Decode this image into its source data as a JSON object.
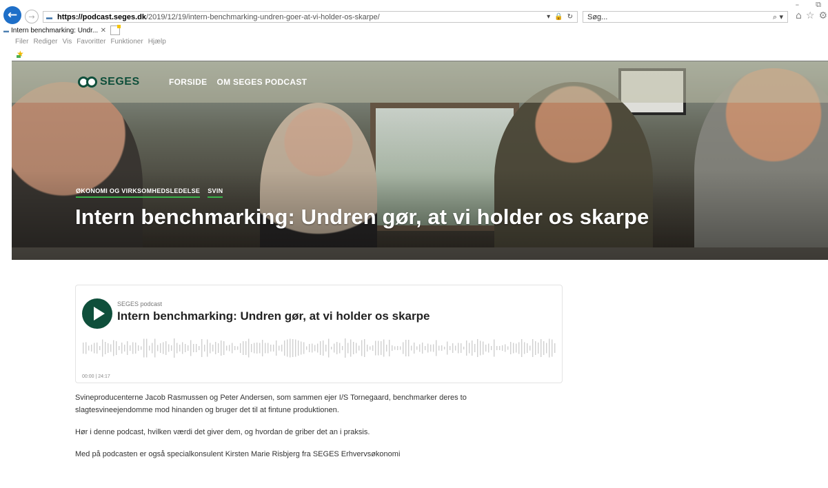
{
  "browser": {
    "url_host": "https://podcast.seges.dk",
    "url_path": "/2019/12/19/intern-benchmarking-undren-goer-at-vi-holder-os-skarpe/",
    "search_placeholder": "Søg...",
    "tab_title": "Intern benchmarking: Undr...",
    "menu": [
      "Filer",
      "Rediger",
      "Vis",
      "Favoritter",
      "Funktioner",
      "Hjælp"
    ],
    "window_controls": [
      "–",
      "⧉"
    ]
  },
  "site": {
    "logo_text": "SEGES",
    "nav": [
      "FORSIDE",
      "OM SEGES PODCAST"
    ],
    "tags": [
      "ØKONOMI OG VIRKSOMHEDSLEDELSE",
      "SVIN"
    ],
    "title": "Intern benchmarking: Undren gør, at vi holder os skarpe"
  },
  "player": {
    "show": "SEGES podcast",
    "episode": "Intern benchmarking: Undren gør, at vi holder os skarpe",
    "time": "00:00 | 24:17",
    "progress": 0
  },
  "article": {
    "paragraphs": [
      "Svineproducenterne Jacob Rasmussen og Peter Andersen, som sammen ejer I/S Tornegaard, benchmarker deres to slagtesvineejendomme mod hinanden og bruger det til at fintune produktionen.",
      "Hør i denne podcast, hvilken værdi det giver dem, og hvordan de griber det an i praksis.",
      "Med på podcasten er også specialkonsulent Kirsten Marie Risbjerg fra SEGES Erhvervsøkonomi"
    ]
  },
  "colors": {
    "brand_green": "#0f4f3b",
    "tag_underline": "#39b54a",
    "browser_blue": "#1e6fc8"
  }
}
